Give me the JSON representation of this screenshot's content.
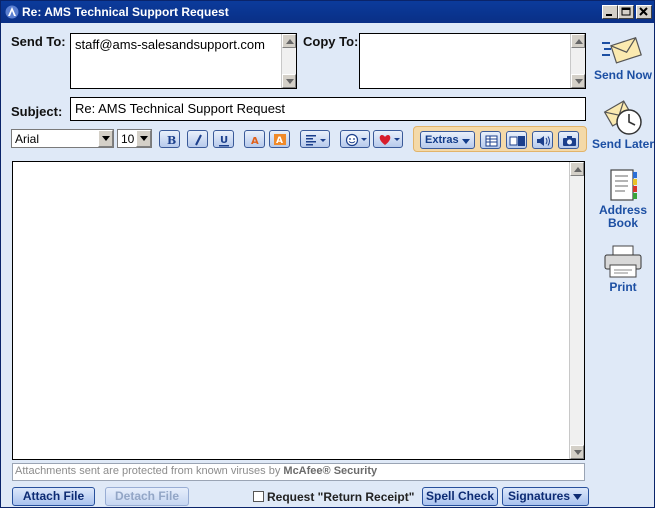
{
  "window": {
    "title": "Re: AMS Technical Support Request"
  },
  "header": {
    "send_to_label": "Send To:",
    "send_to_value": "staff@ams-salesandsupport.com",
    "copy_to_label": "Copy To:",
    "copy_to_value": "",
    "subject_label": "Subject:",
    "subject_value": "Re: AMS Technical Support Request"
  },
  "toolbar": {
    "font_family": "Arial",
    "font_size": "10",
    "extras_label": "Extras"
  },
  "body": {
    "message_text": "",
    "virus_notice_prefix": "Attachments sent are protected from known viruses by ",
    "virus_notice_brand": "McAfee® Security"
  },
  "bottom": {
    "attach_label": "Attach File",
    "detach_label": "Detach File",
    "receipt_label": "Request \"Return Receipt\"",
    "spell_label": "Spell Check",
    "signatures_label": "Signatures"
  },
  "sidebar": {
    "send_now": "Send Now",
    "send_later": "Send Later",
    "address_book_line1": "Address",
    "address_book_line2": "Book",
    "print": "Print"
  },
  "colors": {
    "titlebar": "#0a2f86",
    "accent": "#1c4fa3",
    "extras_bg": "#f4d9a8"
  }
}
